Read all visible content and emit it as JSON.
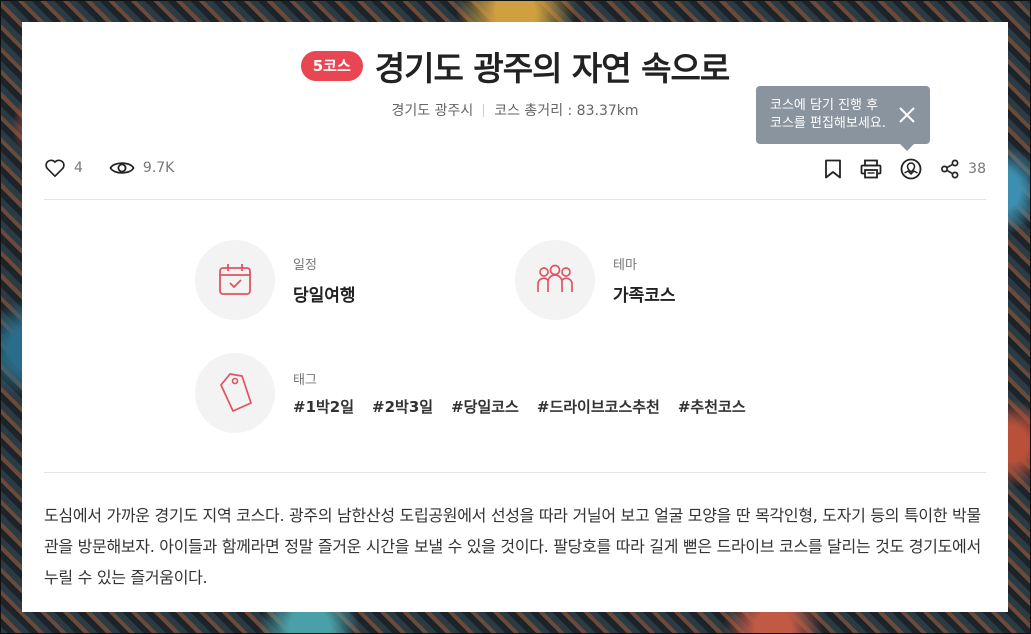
{
  "header": {
    "badge": "5코스",
    "title": "경기도 광주의 자연 속으로",
    "region": "경기도 광주시",
    "distance": "코스 총거리 : 83.37km"
  },
  "tooltip": {
    "line1": "코스에 담기 진행 후",
    "line2": "코스를 편집해보세요."
  },
  "stats": {
    "likes": "4",
    "views": "9.7K",
    "shares": "38"
  },
  "info": {
    "schedule_label": "일정",
    "schedule_value": "당일여행",
    "theme_label": "테마",
    "theme_value": "가족코스",
    "tag_label": "태그",
    "tags": [
      "#1박2일",
      "#2박3일",
      "#당일코스",
      "#드라이브코스추천",
      "#추천코스"
    ]
  },
  "description": "도심에서 가까운 경기도 지역 코스다. 광주의 남한산성 도립공원에서 선성을 따라 거닐어 보고 얼굴 모양을 딴 목각인형, 도자기 등의 특이한 박물관을 방문해보자. 아이들과 함께라면 정말 즐거운 시간을 보낼 수 있을 것이다. 팔당호를 따라 길게 뻗은 드라이브 코스를 달리는 것도 경기도에서 누릴 수 있는 즐거움이다.",
  "colors": {
    "accent": "#e84653",
    "icon_red": "#e05461",
    "tooltip_bg": "#8a949e"
  }
}
